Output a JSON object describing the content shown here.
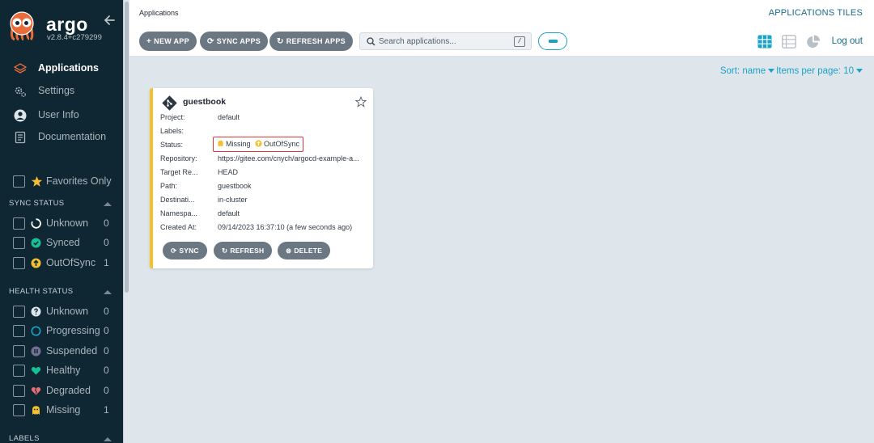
{
  "app": {
    "name": "argo",
    "version": "v2.8.4+c279299"
  },
  "nav": {
    "items": [
      {
        "label": "Applications",
        "icon": "layers-icon",
        "active": true
      },
      {
        "label": "Settings",
        "icon": "gear-icon",
        "active": false
      },
      {
        "label": "User Info",
        "icon": "user-circle-icon",
        "active": false
      },
      {
        "label": "Documentation",
        "icon": "book-icon",
        "active": false
      }
    ]
  },
  "favorites": {
    "label": "Favorites Only"
  },
  "sync_status": {
    "title": "SYNC STATUS",
    "items": [
      {
        "label": "Unknown",
        "count": "0",
        "icon": "circle-notch-icon"
      },
      {
        "label": "Synced",
        "count": "0",
        "icon": "check-circle-icon"
      },
      {
        "label": "OutOfSync",
        "count": "1",
        "icon": "arrow-up-circle-icon"
      }
    ]
  },
  "health_status": {
    "title": "HEALTH STATUS",
    "items": [
      {
        "label": "Unknown",
        "count": "0",
        "icon": "question-circle-icon"
      },
      {
        "label": "Progressing",
        "count": "0",
        "icon": "progress-ring-icon"
      },
      {
        "label": "Suspended",
        "count": "0",
        "icon": "pause-circle-icon"
      },
      {
        "label": "Healthy",
        "count": "0",
        "icon": "heart-icon"
      },
      {
        "label": "Degraded",
        "count": "0",
        "icon": "broken-heart-icon"
      },
      {
        "label": "Missing",
        "count": "1",
        "icon": "ghost-icon"
      }
    ]
  },
  "labels_section": {
    "title": "LABELS"
  },
  "header": {
    "breadcrumb": "Applications",
    "view_title": "APPLICATIONS TILES",
    "logout": "Log out"
  },
  "toolbar": {
    "new_app": "NEW APP",
    "sync_apps": "SYNC APPS",
    "refresh_apps": "REFRESH APPS",
    "search_placeholder": "Search applications...",
    "slash_key": "/"
  },
  "content": {
    "sort_label": "Sort: name",
    "items_per_page": "Items per page: 10"
  },
  "card": {
    "title": "guestbook",
    "rows": [
      {
        "key": "Project:",
        "value": "default"
      },
      {
        "key": "Labels:",
        "value": ""
      },
      {
        "key": "Status:",
        "value": ""
      },
      {
        "key": "Repository:",
        "value": "https://gitee.com/cnych/argocd-example-a..."
      },
      {
        "key": "Target Re...",
        "value": "HEAD"
      },
      {
        "key": "Path:",
        "value": "guestbook"
      },
      {
        "key": "Destinati...",
        "value": "in-cluster"
      },
      {
        "key": "Namespa...",
        "value": "default"
      },
      {
        "key": "Created At:",
        "value": "09/14/2023 16:37:10  (a few seconds ago)"
      }
    ],
    "health": "Missing",
    "sync": "OutOfSync",
    "sync_button": "SYNC",
    "refresh_button": "REFRESH",
    "delete_button": "DELETE"
  },
  "colors": {
    "sidebar_bg": "#0f2733",
    "accent": "#1aa2c7",
    "button_gray": "#6b7783",
    "card_border": "#f4c030",
    "highlight_red": "#e0353b",
    "synced_green": "#18be94",
    "out_of_sync_yellow": "#f4c030",
    "healthy_green": "#18be94",
    "degraded_pink": "#e96d76",
    "suspended_purple": "#766f94"
  }
}
